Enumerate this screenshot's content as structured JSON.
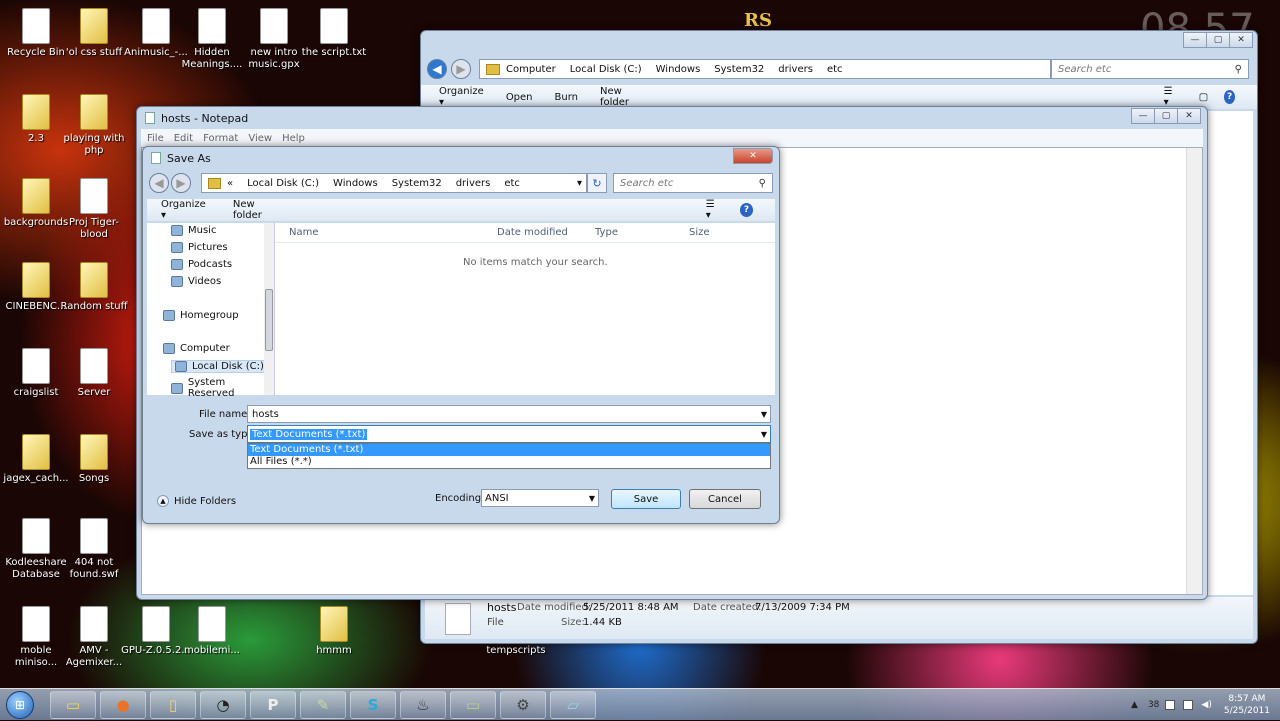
{
  "desktop": {
    "icons": [
      {
        "label": "Recycle Bin",
        "kind": "file"
      },
      {
        "label": "'ol css stuff",
        "kind": "folder"
      },
      {
        "label": "Animusic_-...",
        "kind": "file"
      },
      {
        "label": "Hidden Meanings....",
        "kind": "file"
      },
      {
        "label": "new intro music.gpx",
        "kind": "file"
      },
      {
        "label": "the script.txt",
        "kind": "file"
      },
      {
        "label": "2.3",
        "kind": "folder"
      },
      {
        "label": "playing with php",
        "kind": "folder"
      },
      {
        "label": "backgrounds",
        "kind": "folder"
      },
      {
        "label": "Proj Tiger-blood",
        "kind": "file"
      },
      {
        "label": "CINEBENC...",
        "kind": "folder"
      },
      {
        "label": "Random stuff",
        "kind": "folder"
      },
      {
        "label": "craigslist",
        "kind": "file"
      },
      {
        "label": "Server",
        "kind": "file"
      },
      {
        "label": "jagex_cach...",
        "kind": "folder"
      },
      {
        "label": "Songs",
        "kind": "folder"
      },
      {
        "label": "Kodleeshare Database",
        "kind": "file"
      },
      {
        "label": "404 not found.swf",
        "kind": "file"
      },
      {
        "label": "moble miniso...",
        "kind": "file"
      },
      {
        "label": "AMV - Agemixer...",
        "kind": "file"
      },
      {
        "label": "GPU-Z.0.5.2...",
        "kind": "file"
      },
      {
        "label": "mobilemi...",
        "kind": "file"
      },
      {
        "label": "hmmm",
        "kind": "folder"
      },
      {
        "label": "tempscripts",
        "kind": "folder"
      }
    ],
    "clock_overlay": "08 57",
    "rs_logo": "RS"
  },
  "explorer": {
    "breadcrumb": [
      "Computer",
      "Local Disk (C:)",
      "Windows",
      "System32",
      "drivers",
      "etc"
    ],
    "search_placeholder": "Search etc",
    "toolbar": [
      "Organize ▾",
      "Open",
      "Burn",
      "New folder"
    ],
    "details": {
      "name": "hosts",
      "type": "File",
      "date_modified_label": "Date modified:",
      "date_modified": "5/25/2011 8:48 AM",
      "date_created_label": "Date created:",
      "date_created": "7/13/2009 7:34 PM",
      "size_label": "Size:",
      "size": "1.44 KB"
    }
  },
  "notepad": {
    "title": "hosts - Notepad",
    "menu": [
      "File",
      "Edit",
      "Format",
      "View",
      "Help"
    ]
  },
  "saveas": {
    "title": "Save As",
    "breadcrumb": [
      "«",
      "Local Disk (C:)",
      "Windows",
      "System32",
      "drivers",
      "etc"
    ],
    "search_placeholder": "Search etc",
    "organize": "Organize ▾",
    "new_folder": "New folder",
    "nav": [
      {
        "label": "Music",
        "icon": "music-icon"
      },
      {
        "label": "Pictures",
        "icon": "pictures-icon"
      },
      {
        "label": "Podcasts",
        "icon": "podcasts-icon"
      },
      {
        "label": "Videos",
        "icon": "videos-icon"
      },
      {
        "label": "Homegroup",
        "icon": "homegroup-icon"
      },
      {
        "label": "Computer",
        "icon": "computer-icon"
      },
      {
        "label": "Local Disk (C:)",
        "icon": "drive-icon"
      },
      {
        "label": "System Reserved",
        "icon": "drive-icon"
      }
    ],
    "columns": [
      "Name",
      "Date modified",
      "Type",
      "Size"
    ],
    "empty_text": "No items match your search.",
    "file_name_label": "File name:",
    "file_name_value": "hosts",
    "type_label": "Save as type:",
    "type_value": "Text Documents (*.txt)",
    "type_options": [
      "Text Documents (*.txt)",
      "All Files  (*.*)"
    ],
    "hide_folders": "Hide Folders",
    "encoding_label": "Encoding:",
    "encoding_value": "ANSI",
    "save": "Save",
    "cancel": "Cancel"
  },
  "taskbar": {
    "apps": [
      "Windows Explorer",
      "Firefox",
      "Libraries",
      "Steam-like",
      "P",
      "Notepad++",
      "Skype",
      "Steam",
      "Explorer",
      "Tools",
      "Notepad"
    ],
    "tray_number": "38",
    "time": "8:57 AM",
    "date": "5/25/2011"
  }
}
